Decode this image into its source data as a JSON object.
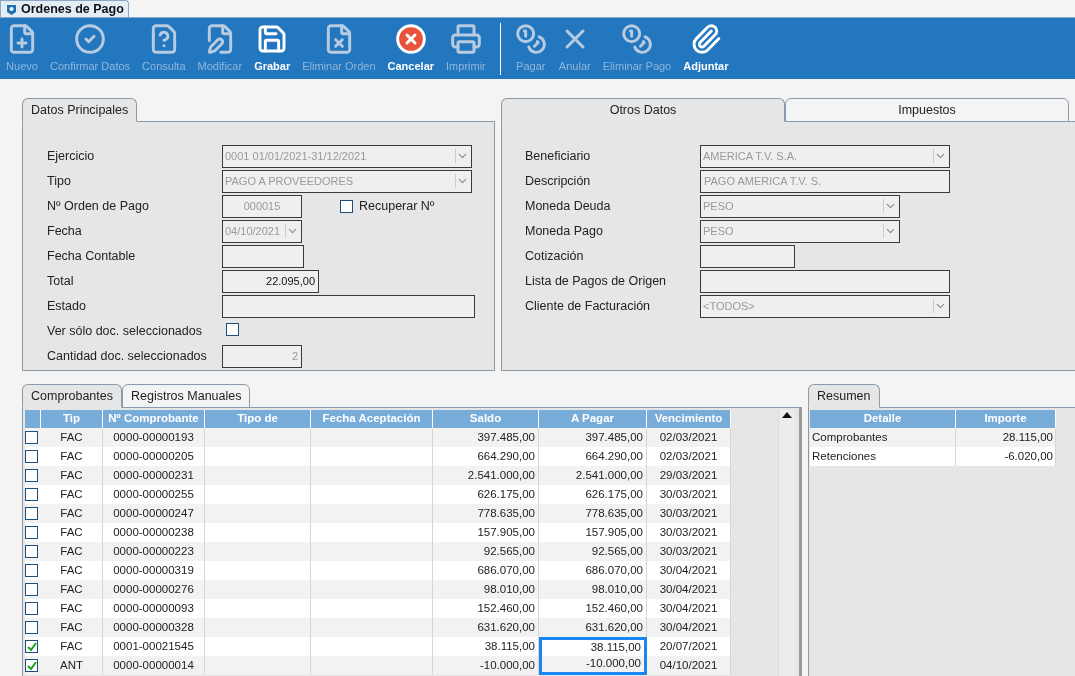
{
  "window": {
    "title": "Ordenes de Pago"
  },
  "toolbar": [
    {
      "label": "Nuevo",
      "enabled": false
    },
    {
      "label": "Confirmar Datos",
      "enabled": false
    },
    {
      "label": "Consulta",
      "enabled": false
    },
    {
      "label": "Modificar",
      "enabled": false
    },
    {
      "label": "Grabar",
      "enabled": true
    },
    {
      "label": "Eliminar Orden",
      "enabled": false
    },
    {
      "label": "Cancelar",
      "enabled": true
    },
    {
      "label": "Imprimir",
      "enabled": false
    },
    {
      "label": "Pagar",
      "enabled": false
    },
    {
      "label": "Anular",
      "enabled": false
    },
    {
      "label": "Eliminar Pago",
      "enabled": false
    },
    {
      "label": "Adjuntar",
      "enabled": true
    }
  ],
  "left_panel": {
    "tabs": [
      {
        "label": "Datos Principales",
        "selected": true
      }
    ],
    "fields": [
      {
        "label": "Ejercicio",
        "kind": "combo",
        "value": "0001 01/01/2021-31/12/2021",
        "disabled": true
      },
      {
        "label": "Tipo",
        "kind": "combo",
        "value": "PAGO A PROVEEDORES",
        "disabled": true
      },
      {
        "label": "Nº Orden de Pago",
        "kind": "text",
        "value": "000015",
        "disabled": true,
        "extra": {
          "label": "Recuperar Nº",
          "checked": false
        }
      },
      {
        "label": "Fecha",
        "kind": "combo",
        "value": "04/10/2021",
        "disabled": true
      },
      {
        "label": "Fecha Contable",
        "kind": "text"
      },
      {
        "label": "Total",
        "kind": "text",
        "value": "22.095,00",
        "disabled": false
      },
      {
        "label": "Estado",
        "kind": "text"
      },
      {
        "label": "Ver sólo doc. seleccionados",
        "kind": "checkbox",
        "checked": false
      },
      {
        "label": "Cantidad doc. seleccionados",
        "kind": "text",
        "value": "2",
        "disabled": true
      }
    ]
  },
  "right_panel": {
    "tabs": [
      {
        "label": "Otros Datos",
        "selected": true
      },
      {
        "label": "Impuestos",
        "selected": false
      }
    ],
    "fields": [
      {
        "label": "Beneficiario",
        "kind": "combo",
        "value": "AMERICA T.V. S.A.",
        "disabled": true
      },
      {
        "label": "Descripción",
        "kind": "text",
        "value": "PAGO AMERICA T.V. S.",
        "disabled": true
      },
      {
        "label": "Moneda Deuda",
        "kind": "combo",
        "value": "PESO",
        "disabled": true
      },
      {
        "label": "Moneda Pago",
        "kind": "combo",
        "value": "PESO",
        "disabled": true
      },
      {
        "label": "Cotización",
        "kind": "text"
      },
      {
        "label": "Lista de Pagos de Origen",
        "kind": "text"
      },
      {
        "label": "Cliente de Facturación",
        "kind": "combo",
        "value": "<TODOS>",
        "disabled": true
      }
    ]
  },
  "documents": {
    "tabs": [
      {
        "label": "Comprobantes",
        "selected": true
      },
      {
        "label": "Registros Manuales",
        "selected": false
      }
    ],
    "columns": [
      "Tip",
      "Nº Comprobante",
      "Tipo de",
      "Fecha Aceptación",
      "Saldo",
      "A Pagar",
      "Vencimiento"
    ],
    "rows": [
      {
        "checked": false,
        "highlighted": false,
        "cells": [
          "FAC",
          "0000-00000193",
          "",
          "",
          "397.485,00",
          "397.485,00",
          "02/03/2021"
        ]
      },
      {
        "checked": false,
        "highlighted": false,
        "cells": [
          "FAC",
          "0000-00000205",
          "",
          "",
          "664.290,00",
          "664.290,00",
          "02/03/2021"
        ]
      },
      {
        "checked": false,
        "highlighted": false,
        "cells": [
          "FAC",
          "0000-00000231",
          "",
          "",
          "2.541.000,00",
          "2.541.000,00",
          "29/03/2021"
        ]
      },
      {
        "checked": false,
        "highlighted": false,
        "cells": [
          "FAC",
          "0000-00000255",
          "",
          "",
          "626.175,00",
          "626.175,00",
          "30/03/2021"
        ]
      },
      {
        "checked": false,
        "highlighted": false,
        "cells": [
          "FAC",
          "0000-00000247",
          "",
          "",
          "778.635,00",
          "778.635,00",
          "30/03/2021"
        ]
      },
      {
        "checked": false,
        "highlighted": false,
        "cells": [
          "FAC",
          "0000-00000238",
          "",
          "",
          "157.905,00",
          "157.905,00",
          "30/03/2021"
        ]
      },
      {
        "checked": false,
        "highlighted": false,
        "cells": [
          "FAC",
          "0000-00000223",
          "",
          "",
          "92.565,00",
          "92.565,00",
          "30/03/2021"
        ]
      },
      {
        "checked": false,
        "highlighted": false,
        "cells": [
          "FAC",
          "0000-00000319",
          "",
          "",
          "686.070,00",
          "686.070,00",
          "30/04/2021"
        ]
      },
      {
        "checked": false,
        "highlighted": false,
        "cells": [
          "FAC",
          "0000-00000276",
          "",
          "",
          "98.010,00",
          "98.010,00",
          "30/04/2021"
        ]
      },
      {
        "checked": false,
        "highlighted": false,
        "cells": [
          "FAC",
          "0000-00000093",
          "",
          "",
          "152.460,00",
          "152.460,00",
          "30/04/2021"
        ]
      },
      {
        "checked": false,
        "highlighted": false,
        "cells": [
          "FAC",
          "0000-00000328",
          "",
          "",
          "631.620,00",
          "631.620,00",
          "30/04/2021"
        ]
      },
      {
        "checked": true,
        "highlighted": true,
        "cells": [
          "FAC",
          "0001-00021545",
          "",
          "",
          "38.115,00",
          "38.115,00",
          "20/07/2021"
        ]
      },
      {
        "checked": true,
        "highlighted": true,
        "cells": [
          "ANT",
          "0000-00000014",
          "",
          "",
          "-10.000,00",
          "-10.000,00",
          "04/10/2021"
        ]
      }
    ]
  },
  "summary": {
    "tabs": [
      {
        "label": "Resumen",
        "selected": true
      }
    ],
    "columns": [
      "Detalle",
      "Importe"
    ],
    "rows": [
      [
        "Comprobantes",
        "28.115,00"
      ],
      [
        "Retenciones",
        "-6.020,00"
      ]
    ]
  }
}
